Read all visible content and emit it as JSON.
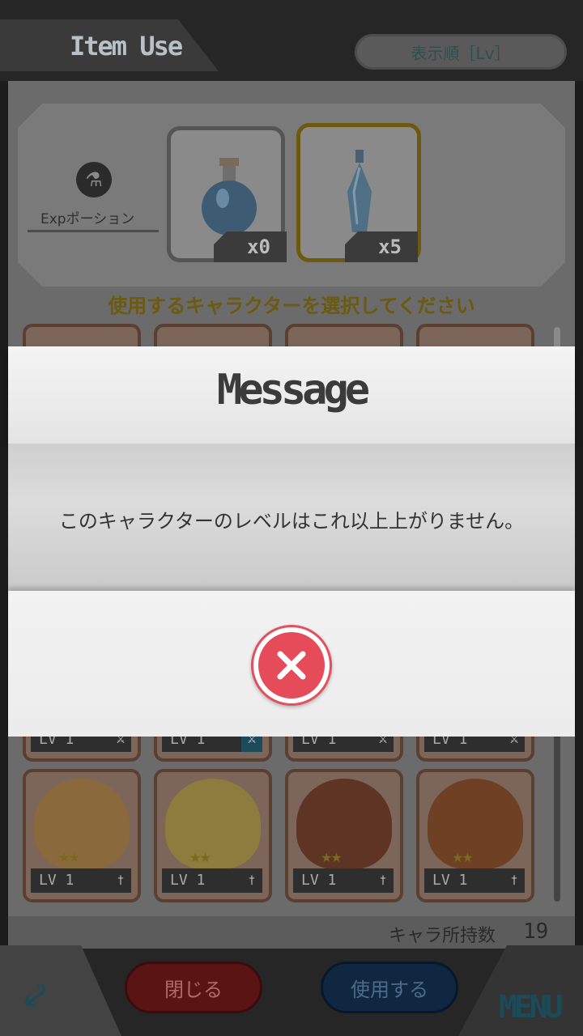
{
  "header": {
    "title": "Item Use",
    "sort_button": "表示順［Lv］"
  },
  "items_panel": {
    "category_label": "Expポーション",
    "category_icon": "flask-icon",
    "items": [
      {
        "name": "blue-potion",
        "count": "x0"
      },
      {
        "name": "crystal-potion",
        "count": "x5"
      }
    ],
    "instruction": "使用するキャラクターを選択してください"
  },
  "characters": [
    {
      "level": "LV 1",
      "stars": "★★"
    },
    {
      "level": "LV 1",
      "stars": "★★"
    },
    {
      "level": "LV 1",
      "stars": "★★"
    },
    {
      "level": "LV 1",
      "stars": "★★"
    },
    {
      "level": "LV 1",
      "stars": "★★"
    },
    {
      "level": "LV 1",
      "stars": "★★"
    },
    {
      "level": "LV 1",
      "stars": "★★"
    },
    {
      "level": "LV 1",
      "stars": "★★"
    }
  ],
  "owned": {
    "label": "キャラ所持数",
    "count": "19"
  },
  "footer": {
    "close_label": "閉じる",
    "use_label": "使用する",
    "menu_label": "MENU"
  },
  "modal": {
    "title": "Message",
    "text": "このキャラクターのレベルはこれ以上上がりません。",
    "close_icon": "close-icon",
    "accent_color": "#e64b5a"
  }
}
